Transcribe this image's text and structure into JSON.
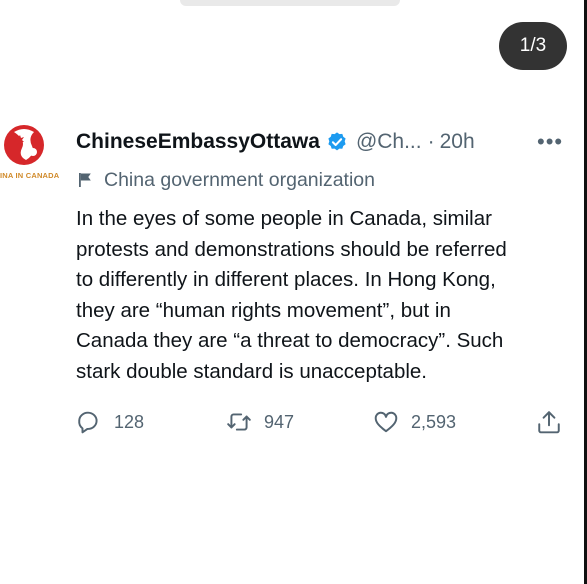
{
  "pager": {
    "label": "1/3"
  },
  "avatar": {
    "caption": "INA IN CANADA"
  },
  "tweet": {
    "display_name": "ChineseEmbassyOttawa",
    "handle": "@Ch...",
    "dot": "·",
    "time": "20h",
    "more": "•••",
    "org_label": "China government organization",
    "lines": [
      "In the eyes of some people in Canada, similar",
      "protests and demonstrations should be referred",
      "to differently in different places. In Hong Kong,",
      "they are “human rights movement”, but in",
      "Canada they are “a threat to democracy”. Such",
      "stark double standard is unacceptable."
    ]
  },
  "actions": {
    "replies": "128",
    "retweets": "947",
    "likes": "2,593"
  },
  "colors": {
    "verified": "#1d9bf0",
    "muted": "#536471",
    "text": "#0f1419",
    "avatar_red": "#d6272a",
    "avatar_gold": "#d08a2a"
  },
  "icons": [
    "reply-icon",
    "retweet-icon",
    "like-icon",
    "share-icon",
    "verified-badge-icon",
    "government-flag-icon",
    "more-icon"
  ]
}
